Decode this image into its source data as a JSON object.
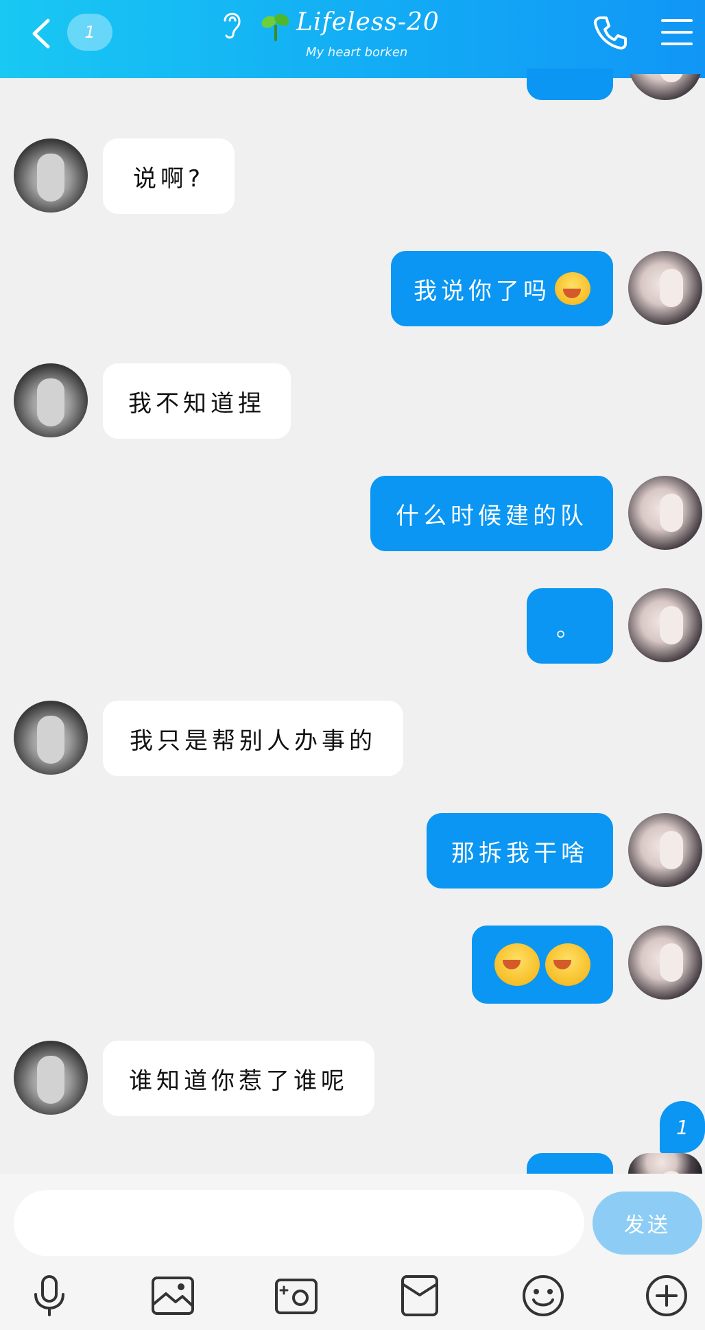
{
  "header": {
    "unread_count": "1",
    "title": "Lifeless-20",
    "subtitle": "My heart borken"
  },
  "messages": [
    {
      "side": "left",
      "text": "说啊?"
    },
    {
      "side": "right",
      "text": "我说你了吗",
      "emoji": "crying-laughing-emoji"
    },
    {
      "side": "left",
      "text": "我不知道捏"
    },
    {
      "side": "right",
      "text": "什么时候建的队"
    },
    {
      "side": "right",
      "text": "。"
    },
    {
      "side": "left",
      "text": "我只是帮别人办事的"
    },
    {
      "side": "right",
      "text": "那拆我干啥"
    },
    {
      "side": "right",
      "text": "",
      "emoji": "crying-laughing-emoji x2"
    },
    {
      "side": "left",
      "text": "谁知道你惹了谁呢"
    }
  ],
  "new_message_badge": "1",
  "composer": {
    "placeholder": "",
    "send_label": "发送"
  },
  "toolbar": [
    "microphone-icon",
    "image-icon",
    "camera-icon",
    "red-packet-icon",
    "smiley-icon",
    "plus-icon"
  ],
  "colors": {
    "header_start": "#19c8f3",
    "header_end": "#1196f6",
    "bubble_self": "#0a96f2",
    "bubble_other": "#ffffff",
    "send_button": "#8dcdf5"
  }
}
